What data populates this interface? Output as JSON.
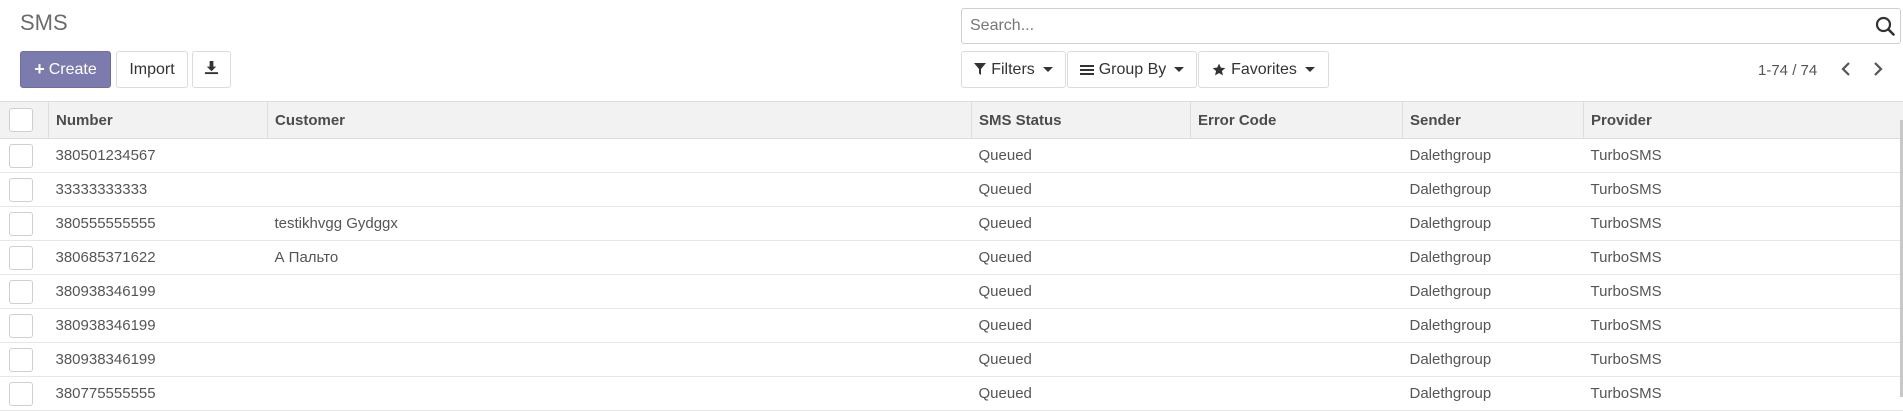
{
  "header": {
    "title": "SMS"
  },
  "toolbar": {
    "create_label": "Create",
    "import_label": "Import"
  },
  "search": {
    "placeholder": "Search..."
  },
  "filters": {
    "filters_label": "Filters",
    "groupby_label": "Group By",
    "favorites_label": "Favorites"
  },
  "pager": {
    "value": "1-74 / 74"
  },
  "table": {
    "columns": [
      "Number",
      "Customer",
      "SMS Status",
      "Error Code",
      "Sender",
      "Provider"
    ],
    "rows": [
      {
        "number": "380501234567",
        "customer": "",
        "status": "Queued",
        "error": "",
        "sender": "Dalethgroup",
        "provider": "TurboSMS"
      },
      {
        "number": "33333333333",
        "customer": "",
        "status": "Queued",
        "error": "",
        "sender": "Dalethgroup",
        "provider": "TurboSMS"
      },
      {
        "number": "380555555555",
        "customer": "testikhvgg Gydggx",
        "status": "Queued",
        "error": "",
        "sender": "Dalethgroup",
        "provider": "TurboSMS"
      },
      {
        "number": "380685371622",
        "customer": "А Пальто",
        "status": "Queued",
        "error": "",
        "sender": "Dalethgroup",
        "provider": "TurboSMS"
      },
      {
        "number": "380938346199",
        "customer": "",
        "status": "Queued",
        "error": "",
        "sender": "Dalethgroup",
        "provider": "TurboSMS"
      },
      {
        "number": "380938346199",
        "customer": "",
        "status": "Queued",
        "error": "",
        "sender": "Dalethgroup",
        "provider": "TurboSMS"
      },
      {
        "number": "380938346199",
        "customer": "",
        "status": "Queued",
        "error": "",
        "sender": "Dalethgroup",
        "provider": "TurboSMS"
      },
      {
        "number": "380775555555",
        "customer": "",
        "status": "Queued",
        "error": "",
        "sender": "Dalethgroup",
        "provider": "TurboSMS"
      }
    ]
  },
  "colors": {
    "primary": "#7c7bad",
    "header_bg": "#f2f2f2"
  }
}
